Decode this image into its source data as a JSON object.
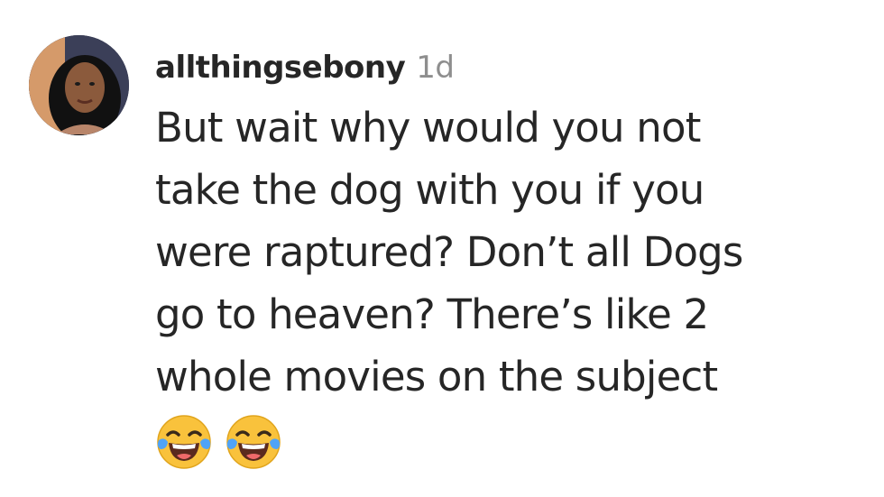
{
  "comment": {
    "username": "allthingsebony",
    "timestamp": "1d",
    "text_lines": [
      "But wait why would you not",
      "take the dog with you if you",
      "were raptured? Don’t all Dogs",
      "go to heaven? There’s like 2",
      "whole movies on the subject"
    ],
    "emojis": [
      "face-with-tears-of-joy-icon",
      "face-with-tears-of-joy-icon"
    ]
  },
  "colors": {
    "text": "#262626",
    "muted": "#8e8e8e",
    "emoji_yellow": "#f9c23c"
  }
}
